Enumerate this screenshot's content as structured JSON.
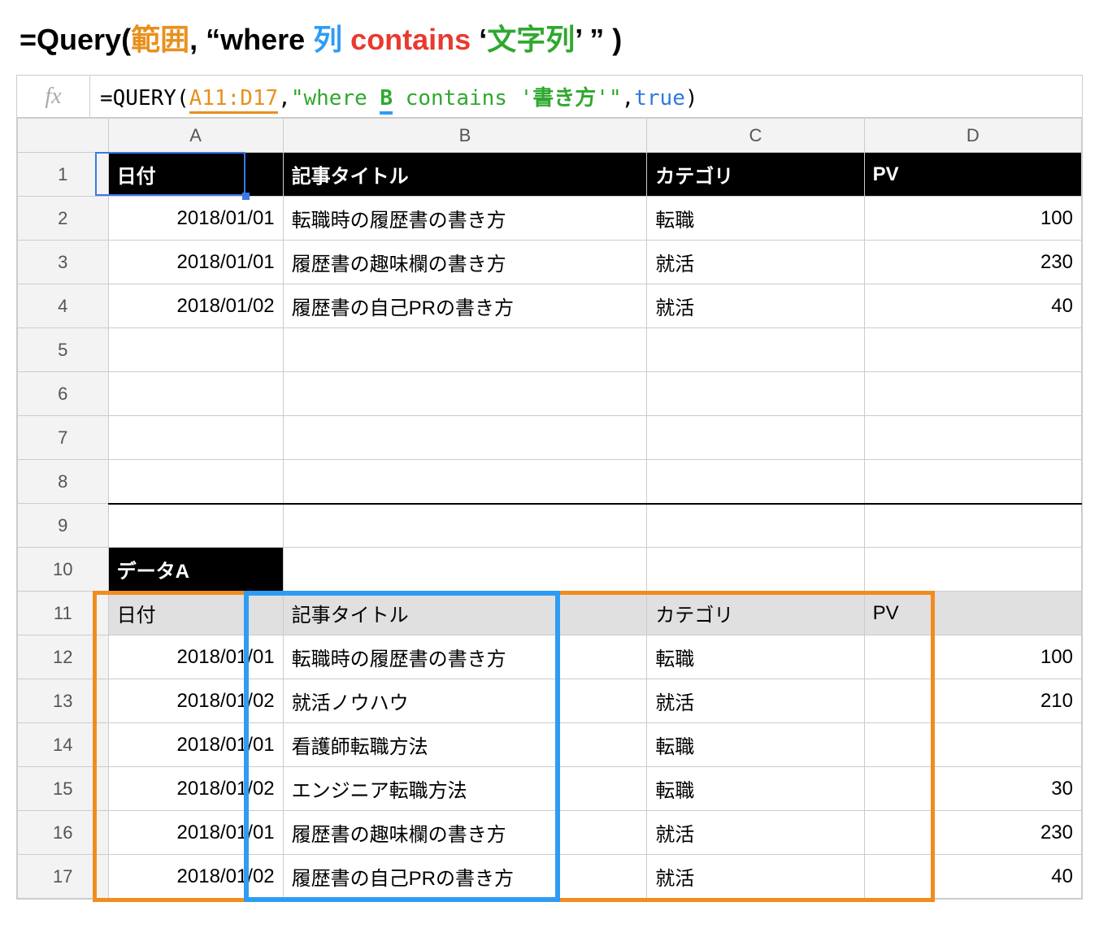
{
  "title": {
    "prefix": "=Query(",
    "range": "範囲",
    "sep1": ", “",
    "where": "where ",
    "col": "列",
    "space": " ",
    "contains": "contains",
    "sq1": " ‘",
    "str": "文字列",
    "sq2": "’ ",
    "end": "” )"
  },
  "formula": {
    "eq": "=",
    "fn": "QUERY",
    "open": "(",
    "range": "A11:D17",
    "c1": ",",
    "q1": "\"",
    "where": "where ",
    "col": "B",
    "sp": " ",
    "contains": "contains ",
    "sq1": "'",
    "str": "書き方",
    "sq2": "'",
    "q2": "\"",
    "c2": ",",
    "true": "true",
    "close": ")"
  },
  "colHeaders": [
    "A",
    "B",
    "C",
    "D"
  ],
  "rowHeaders": [
    "1",
    "2",
    "3",
    "4",
    "5",
    "6",
    "7",
    "8",
    "9",
    "10",
    "11",
    "12",
    "13",
    "14",
    "15",
    "16",
    "17"
  ],
  "result": {
    "header": [
      "日付",
      "記事タイトル",
      "カテゴリ",
      "PV"
    ],
    "rows": [
      [
        "2018/01/01",
        "転職時の履歴書の書き方",
        "転職",
        "100"
      ],
      [
        "2018/01/01",
        "履歴書の趣味欄の書き方",
        "就活",
        "230"
      ],
      [
        "2018/01/02",
        "履歴書の自己PRの書き方",
        "就活",
        "40"
      ]
    ]
  },
  "blockLabel": "データA",
  "source": {
    "header": [
      "日付",
      "記事タイトル",
      "カテゴリ",
      "PV"
    ],
    "rows": [
      [
        "2018/01/01",
        "転職時の履歴書の書き方",
        "転職",
        "100"
      ],
      [
        "2018/01/02",
        "就活ノウハウ",
        "就活",
        "210"
      ],
      [
        "2018/01/01",
        "看護師転職方法",
        "転職",
        ""
      ],
      [
        "2018/01/02",
        "エンジニア転職方法",
        "転職",
        "30"
      ],
      [
        "2018/01/01",
        "履歴書の趣味欄の書き方",
        "就活",
        "230"
      ],
      [
        "2018/01/02",
        "履歴書の自己PRの書き方",
        "就活",
        "40"
      ]
    ]
  }
}
